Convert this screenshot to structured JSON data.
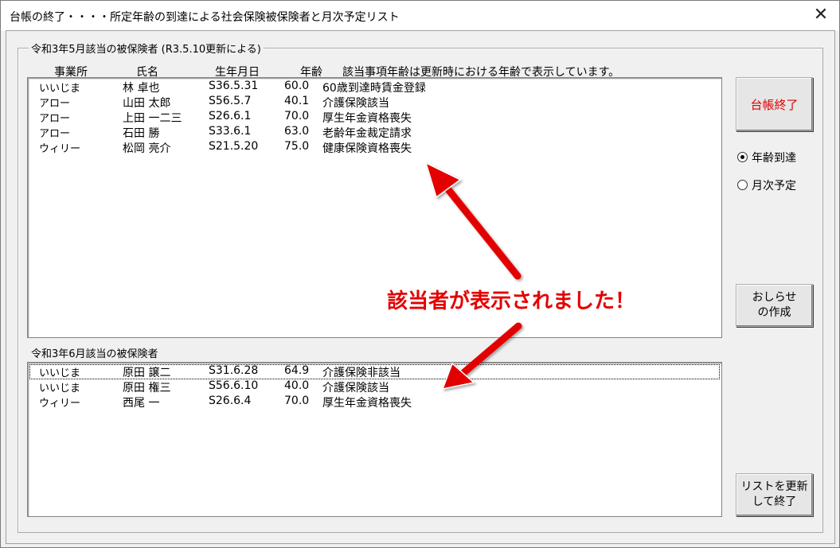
{
  "window": {
    "title": "台帳の終了・・・・所定年齢の到達による社会保険被保険者と月次予定リスト",
    "close_glyph": "✕"
  },
  "group": {
    "title": "令和3年5月該当の被保険者 (R3.5.10更新による)"
  },
  "columns": {
    "office": "事業所",
    "name": "氏名",
    "birth": "生年月日",
    "age": "年齢",
    "note": "該当事項年齢は更新時における年齢で表示しています。"
  },
  "list_may": [
    {
      "office": "いいじま",
      "name": "林 卓也",
      "birth": "S36.5.31",
      "age": "60.0",
      "item": "60歳到達時賃金登録"
    },
    {
      "office": "アロー",
      "name": "山田 太郎",
      "birth": "S56.5.7",
      "age": "40.1",
      "item": "介護保険該当"
    },
    {
      "office": "アロー",
      "name": "上田 一二三",
      "birth": "S26.6.1",
      "age": "70.0",
      "item": "厚生年金資格喪失"
    },
    {
      "office": "アロー",
      "name": "石田 勝",
      "birth": "S33.6.1",
      "age": "63.0",
      "item": "老齢年金裁定請求"
    },
    {
      "office": "ウィリー",
      "name": "松岡 亮介",
      "birth": "S21.5.20",
      "age": "75.0",
      "item": "健康保険資格喪失"
    }
  ],
  "june_label": "令和3年6月該当の被保険者",
  "list_june": [
    {
      "office": "いいじま",
      "name": "原田 譲二",
      "birth": "S31.6.28",
      "age": "64.9",
      "item": "介護保険非該当"
    },
    {
      "office": "いいじま",
      "name": "原田 権三",
      "birth": "S56.6.10",
      "age": "40.0",
      "item": "介護保険該当"
    },
    {
      "office": "ウィリー",
      "name": "西尾 一",
      "birth": "S26.6.4",
      "age": "70.0",
      "item": "厚生年金資格喪失"
    }
  ],
  "buttons": {
    "close_ledger": "台帳終了",
    "notice": "おしらせ\nの作成",
    "update_close": "リストを更新\nして終了"
  },
  "radios": {
    "age_reached": "年齢到達",
    "monthly": "月次予定",
    "selected": "age_reached"
  },
  "annotation": {
    "text": "該当者が表示されました！",
    "color": "#e30000"
  }
}
